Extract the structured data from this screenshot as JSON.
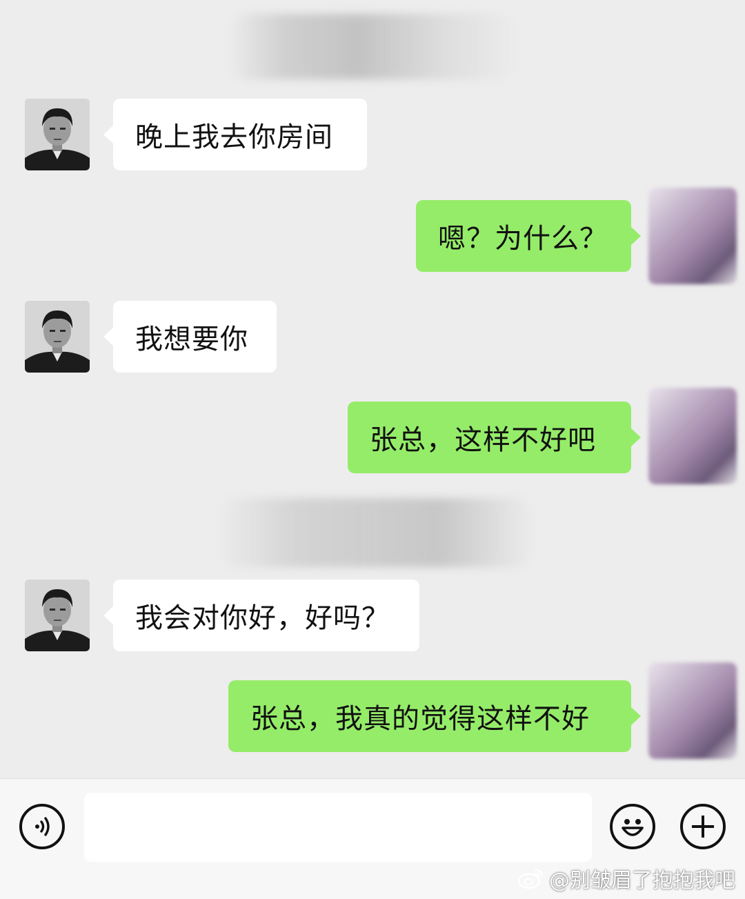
{
  "chat": {
    "messages": [
      {
        "sender": "other",
        "text": "晚上我去你房间"
      },
      {
        "sender": "me",
        "text": "嗯？为什么？"
      },
      {
        "sender": "other",
        "text": "我想要你"
      },
      {
        "sender": "me",
        "text": "张总，这样不好吧"
      },
      {
        "sender": "other",
        "text": "我会对你好，好吗？"
      },
      {
        "sender": "me",
        "text": "张总，我真的觉得这样不好"
      }
    ]
  },
  "input_bar": {
    "voice_icon": "voice-icon",
    "emoji_icon": "emoji-icon",
    "plus_icon": "plus-icon",
    "text_value": ""
  },
  "watermark": {
    "text": "@别皱眉了抱抱我吧",
    "icon": "weibo-logo"
  },
  "colors": {
    "background": "#ededed",
    "outgoing_bubble": "#95ec69",
    "incoming_bubble": "#ffffff"
  }
}
